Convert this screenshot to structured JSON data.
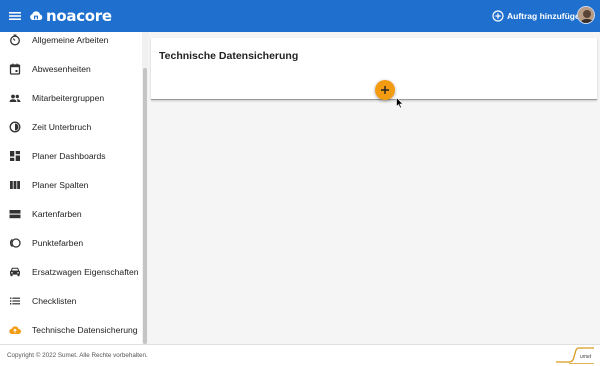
{
  "header": {
    "brand": "noacore",
    "add_order_label": "Auftrag hinzufügen",
    "bg_color": "#1e6fce"
  },
  "sidebar": {
    "items": [
      {
        "label": "Allgemeine Arbeiten",
        "icon": "timer-icon"
      },
      {
        "label": "Abwesenheiten",
        "icon": "calendar-icon"
      },
      {
        "label": "Mitarbeitergruppen",
        "icon": "people-icon"
      },
      {
        "label": "Zeit Unterbruch",
        "icon": "clock-half-icon"
      },
      {
        "label": "Planer Dashboards",
        "icon": "dashboard-icon"
      },
      {
        "label": "Planer Spalten",
        "icon": "columns-icon"
      },
      {
        "label": "Kartenfarben",
        "icon": "card-color-icon"
      },
      {
        "label": "Punktefarben",
        "icon": "dots-color-icon"
      },
      {
        "label": "Ersatzwagen Eigenschaften",
        "icon": "car-icon"
      },
      {
        "label": "Checklisten",
        "icon": "list-icon"
      },
      {
        "label": "Technische Datensicherung",
        "icon": "cloud-upload-icon",
        "active": true
      }
    ],
    "active_color": "#f39c12"
  },
  "main": {
    "card_title": "Technische Datensicherung",
    "fab_color": "#f39c12"
  },
  "footer": {
    "copyright": "Copyright © 2022 Sumet. Alle Rechte vorbehalten.",
    "logo_text": "Sumet"
  }
}
